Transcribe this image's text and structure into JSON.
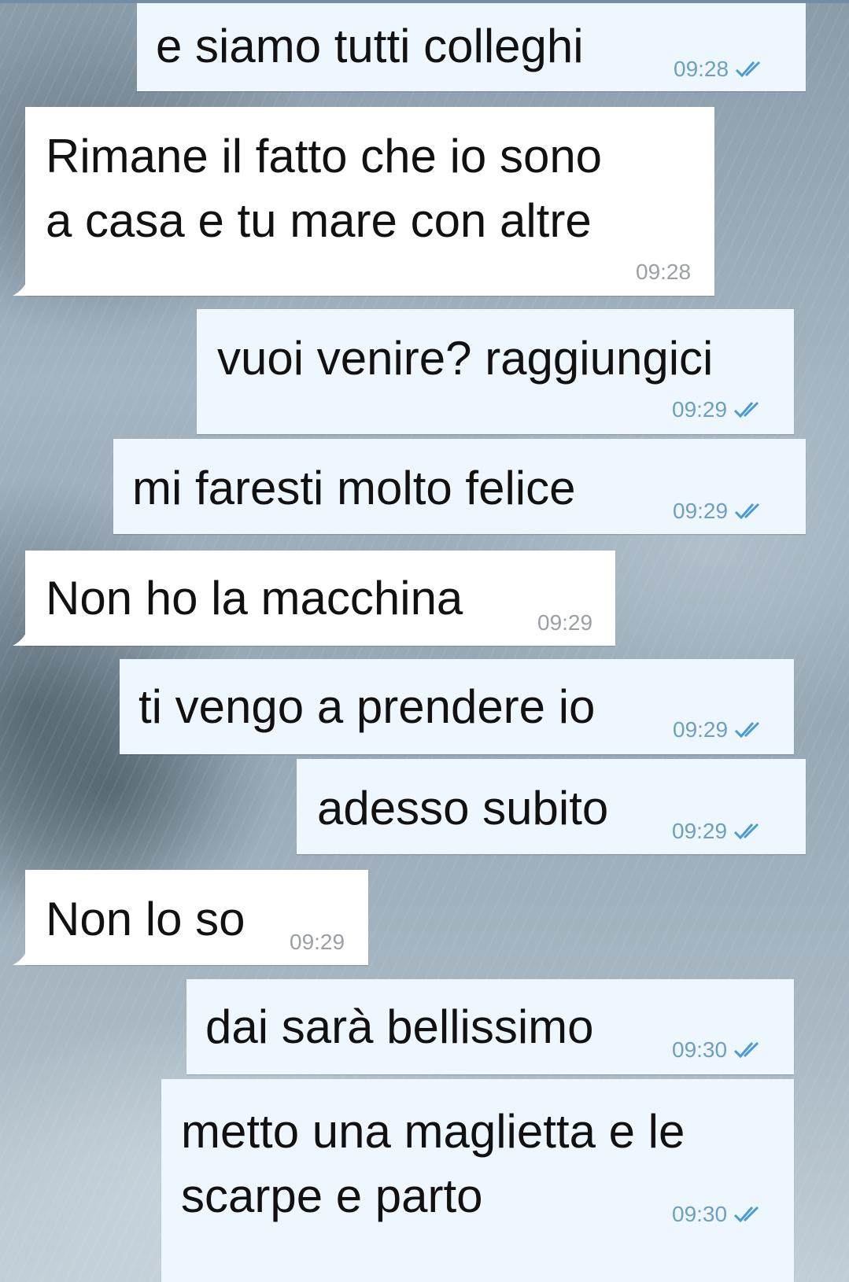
{
  "chat": {
    "colors": {
      "outgoing_bubble": "#eef7fd",
      "incoming_bubble": "#ffffff",
      "outgoing_meta": "#6f9fbf",
      "incoming_meta": "#9aa0a5",
      "read_check": "#4a9ad4"
    },
    "messages": [
      {
        "direction": "out",
        "text": "e siamo tutti colleghi",
        "time": "09:28",
        "status_icon": "double-check-icon"
      },
      {
        "direction": "in",
        "text": "Rimane il fatto che io sono\na casa e tu mare con altre",
        "time": "09:28"
      },
      {
        "direction": "out",
        "text": "vuoi venire? raggiungici",
        "time": "09:29",
        "status_icon": "double-check-icon"
      },
      {
        "direction": "out",
        "text": "mi faresti molto felice",
        "time": "09:29",
        "status_icon": "double-check-icon"
      },
      {
        "direction": "in",
        "text": "Non ho la macchina",
        "time": "09:29"
      },
      {
        "direction": "out",
        "text": "ti vengo a prendere io",
        "time": "09:29",
        "status_icon": "double-check-icon"
      },
      {
        "direction": "out",
        "text": "adesso subito",
        "time": "09:29",
        "status_icon": "double-check-icon"
      },
      {
        "direction": "in",
        "text": "Non lo so",
        "time": "09:29"
      },
      {
        "direction": "out",
        "text": "dai sarà bellissimo",
        "time": "09:30",
        "status_icon": "double-check-icon"
      },
      {
        "direction": "out",
        "text": "metto una maglietta e le\nscarpe e parto",
        "time": "09:30",
        "status_icon": "double-check-icon"
      }
    ]
  }
}
